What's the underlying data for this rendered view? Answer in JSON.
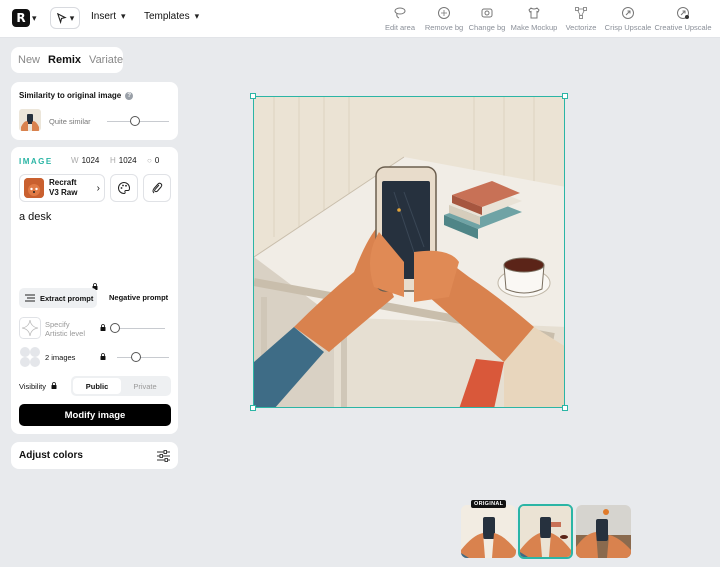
{
  "topbar": {
    "logo_icon": "recraft-logo-icon",
    "menus": [
      {
        "label": "Insert"
      },
      {
        "label": "Templates"
      }
    ],
    "tools": [
      {
        "label": "Edit area",
        "icon": "lasso-icon"
      },
      {
        "label": "Remove bg",
        "icon": "remove-bg-icon"
      },
      {
        "label": "Change bg",
        "icon": "change-bg-icon"
      },
      {
        "label": "Make Mockup",
        "icon": "shirt-icon"
      },
      {
        "label": "Vectorize",
        "icon": "vector-nodes-icon"
      },
      {
        "label": "Crisp Upscale",
        "icon": "crisp-upscale-icon"
      },
      {
        "label": "Creative Upscale",
        "icon": "creative-upscale-icon"
      }
    ]
  },
  "tabs": [
    {
      "label": "New",
      "active": false
    },
    {
      "label": "Remix",
      "active": true
    },
    {
      "label": "Variate",
      "active": false
    }
  ],
  "similarity": {
    "title": "Similarity to original image",
    "value_label": "Quite similar"
  },
  "image_settings": {
    "section_label": "IMAGE",
    "width_key": "W",
    "width": "1024",
    "height_key": "H",
    "height": "1024",
    "seed": "0",
    "model_line1": "Recraft",
    "model_line2": "V3 Raw",
    "prompt": "a desk",
    "extract_prompt_label": "Extract prompt",
    "negative_prompt_label": "Negative prompt",
    "artistic_label_line1": "Specify",
    "artistic_label_line2": "Artistic level",
    "images_label": "2 images",
    "visibility_label": "Visibility",
    "visibility_options": [
      "Public",
      "Private"
    ],
    "visibility_selected": "Public",
    "modify_button": "Modify image"
  },
  "adjust": {
    "label": "Adjust colors"
  },
  "thumbnails": {
    "original_badge": "ORIGINAL",
    "selected_index": 1
  },
  "colors": {
    "accent": "#2bb5a5",
    "button_dark": "#000000"
  }
}
